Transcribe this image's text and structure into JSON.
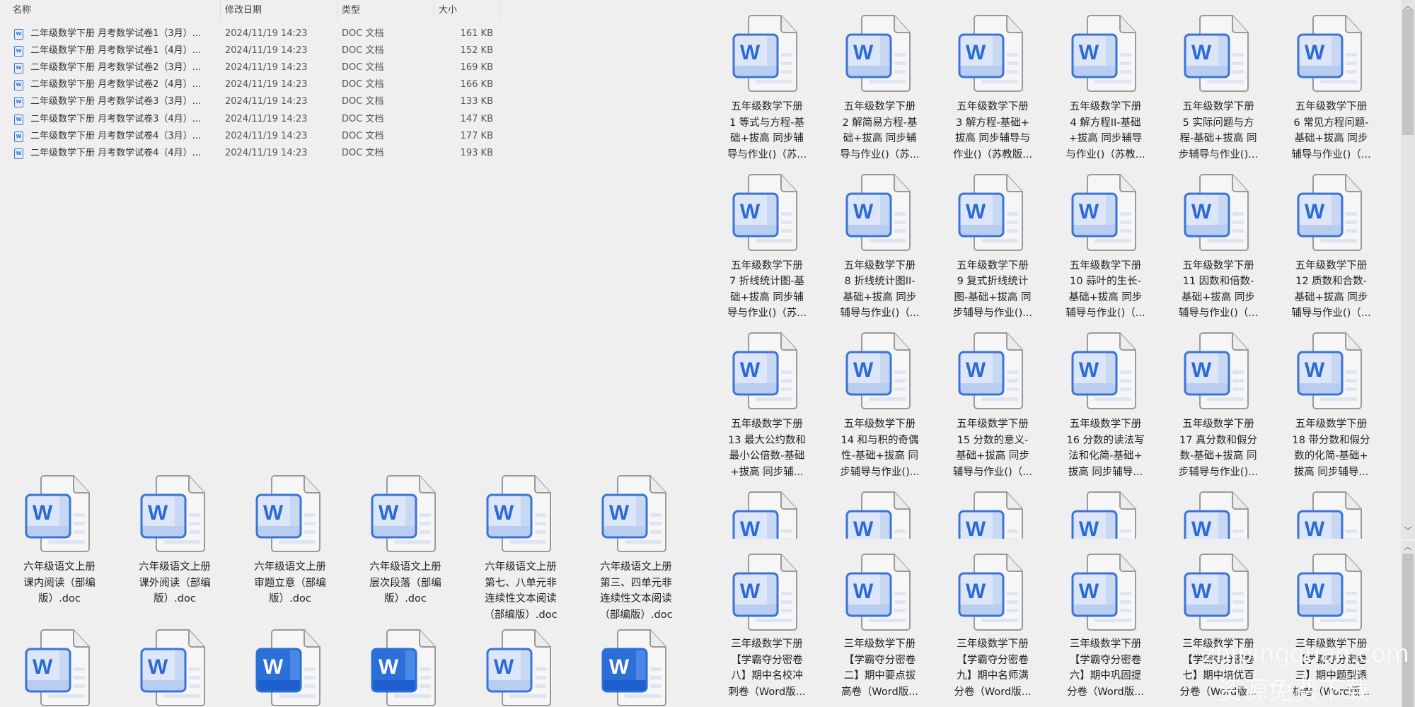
{
  "list": {
    "headers": {
      "name": "名称",
      "date": "修改日期",
      "type": "类型",
      "size": "大小"
    },
    "rows": [
      {
        "name": "二年级数学下册  月考数学试卷1（3月）...",
        "date": "2024/11/19 14:23",
        "type": "DOC 文档",
        "size": "161 KB"
      },
      {
        "name": "二年级数学下册  月考数学试卷1（4月）...",
        "date": "2024/11/19 14:23",
        "type": "DOC 文档",
        "size": "152 KB"
      },
      {
        "name": "二年级数学下册  月考数学试卷2（3月）...",
        "date": "2024/11/19 14:23",
        "type": "DOC 文档",
        "size": "169 KB"
      },
      {
        "name": "二年级数学下册  月考数学试卷2（4月）...",
        "date": "2024/11/19 14:23",
        "type": "DOC 文档",
        "size": "166 KB"
      },
      {
        "name": "二年级数学下册  月考数学试卷3（3月）...",
        "date": "2024/11/19 14:23",
        "type": "DOC 文档",
        "size": "133 KB"
      },
      {
        "name": "二年级数学下册  月考数学试卷3（4月）...",
        "date": "2024/11/19 14:23",
        "type": "DOC 文档",
        "size": "147 KB"
      },
      {
        "name": "二年级数学下册  月考数学试卷4（3月）...",
        "date": "2024/11/19 14:23",
        "type": "DOC 文档",
        "size": "177 KB"
      },
      {
        "name": "二年级数学下册  月考数学试卷4（4月）...",
        "date": "2024/11/19 14:23",
        "type": "DOC 文档",
        "size": "193 KB"
      }
    ]
  },
  "left_grid": {
    "items": [
      {
        "style": "light",
        "lines": [
          "六年级语文上册",
          "课内阅读（部编",
          "版）.doc"
        ]
      },
      {
        "style": "light",
        "lines": [
          "六年级语文上册",
          "课外阅读（部编",
          "版）.doc"
        ]
      },
      {
        "style": "light",
        "lines": [
          "六年级语文上册",
          "审题立意（部编",
          "版）.doc"
        ]
      },
      {
        "style": "light",
        "lines": [
          "六年级语文上册",
          "层次段落（部编",
          "版）.doc"
        ]
      },
      {
        "style": "light",
        "lines": [
          "六年级语文上册",
          "第七、八单元非",
          "连续性文本阅读",
          "（部编版）.doc"
        ]
      },
      {
        "style": "light",
        "lines": [
          "六年级语文上册",
          "第三、四单元非",
          "连续性文本阅读",
          "（部编版）.doc"
        ]
      },
      {
        "style": "light",
        "lines": []
      },
      {
        "style": "light",
        "lines": []
      },
      {
        "style": "solid",
        "lines": []
      },
      {
        "style": "solid",
        "lines": []
      },
      {
        "style": "light",
        "lines": []
      },
      {
        "style": "solid",
        "lines": []
      }
    ]
  },
  "right_top": {
    "items": [
      {
        "style": "light",
        "lines": [
          "五年级数学下册",
          "1 等式与方程-基",
          "础+拔高 同步辅",
          "导与作业()（苏..."
        ]
      },
      {
        "style": "light",
        "lines": [
          "五年级数学下册",
          "2 解简易方程-基",
          "础+拔高 同步辅",
          "导与作业()（苏..."
        ]
      },
      {
        "style": "light",
        "lines": [
          "五年级数学下册",
          "3 解方程-基础+",
          "拔高 同步辅导与",
          "作业()（苏教版..."
        ]
      },
      {
        "style": "light",
        "lines": [
          "五年级数学下册",
          "4 解方程II-基础",
          "+拔高 同步辅导",
          "与作业()（苏教..."
        ]
      },
      {
        "style": "light",
        "lines": [
          "五年级数学下册",
          "5 实际问题与方",
          "程-基础+拔高 同",
          "步辅导与作业()..."
        ]
      },
      {
        "style": "light",
        "lines": [
          "五年级数学下册",
          "6 常见方程问题-",
          "基础+拔高 同步",
          "辅导与作业()（..."
        ]
      },
      {
        "style": "light",
        "lines": [
          "五年级数学下册",
          "7 折线统计图-基",
          "础+拔高 同步辅",
          "导与作业()（苏..."
        ]
      },
      {
        "style": "light",
        "lines": [
          "五年级数学下册",
          "8 折线统计图II-",
          "基础+拔高 同步",
          "辅导与作业()（..."
        ]
      },
      {
        "style": "light",
        "lines": [
          "五年级数学下册",
          "9 复式折线统计",
          "图-基础+拔高 同",
          "步辅导与作业()..."
        ]
      },
      {
        "style": "light",
        "lines": [
          "五年级数学下册",
          "10 蒜叶的生长-",
          "基础+拔高 同步",
          "辅导与作业()（..."
        ]
      },
      {
        "style": "light",
        "lines": [
          "五年级数学下册",
          "11 因数和倍数-",
          "基础+拔高 同步",
          "辅导与作业()（..."
        ]
      },
      {
        "style": "light",
        "lines": [
          "五年级数学下册",
          "12 质数和合数-",
          "基础+拔高 同步",
          "辅导与作业()（..."
        ]
      },
      {
        "style": "light",
        "lines": [
          "五年级数学下册",
          "13 最大公约数和",
          "最小公倍数-基础",
          "+拔高 同步辅..."
        ]
      },
      {
        "style": "light",
        "lines": [
          "五年级数学下册",
          "14 和与积的奇偶",
          "性-基础+拔高 同",
          "步辅导与作业()..."
        ]
      },
      {
        "style": "light",
        "lines": [
          "五年级数学下册",
          "15 分数的意义-",
          "基础+拔高 同步",
          "辅导与作业()（..."
        ]
      },
      {
        "style": "light",
        "lines": [
          "五年级数学下册",
          "16 分数的读法写",
          "法和化简-基础+",
          "拔高 同步辅导..."
        ]
      },
      {
        "style": "light",
        "lines": [
          "五年级数学下册",
          "17 真分数和假分",
          "数-基础+拔高 同",
          "步辅导与作业()..."
        ]
      },
      {
        "style": "light",
        "lines": [
          "五年级数学下册",
          "18 带分数和假分",
          "数的化简-基础+",
          "拔高 同步辅导..."
        ]
      },
      {
        "style": "light",
        "lines": []
      },
      {
        "style": "light",
        "lines": []
      },
      {
        "style": "light",
        "lines": []
      },
      {
        "style": "light",
        "lines": []
      },
      {
        "style": "light",
        "lines": []
      },
      {
        "style": "light",
        "lines": []
      }
    ]
  },
  "right_bottom": {
    "items": [
      {
        "style": "light",
        "lines": [
          "三年级数学下册",
          "【学霸夺分密卷",
          "八】期中名校冲",
          "刺卷（Word版..."
        ]
      },
      {
        "style": "light",
        "lines": [
          "三年级数学下册",
          "【学霸夺分密卷",
          "二】期中要点拔",
          "高卷（Word版..."
        ]
      },
      {
        "style": "light",
        "lines": [
          "三年级数学下册",
          "【学霸夺分密卷",
          "九】期中名师满",
          "分卷（Word版..."
        ]
      },
      {
        "style": "light",
        "lines": [
          "三年级数学下册",
          "【学霸夺分密卷",
          "六】期中巩固提",
          "分卷（Word版..."
        ]
      },
      {
        "style": "light",
        "lines": [
          "三年级数学下册",
          "【学霸夺分密卷",
          "七】期中培优百",
          "分卷（Word版..."
        ]
      },
      {
        "style": "light",
        "lines": [
          "三年级数学下册",
          "【学霸夺分密卷",
          "三】期中题型透",
          "析卷（Word版..."
        ]
      }
    ]
  },
  "watermark": {
    "line1": "zhipingquan.com",
    "line2": "资源免费下载"
  },
  "colors": {
    "accent": "#2b6fd9",
    "icon_light_fill": "#dce6f8",
    "background": "#efefef"
  }
}
